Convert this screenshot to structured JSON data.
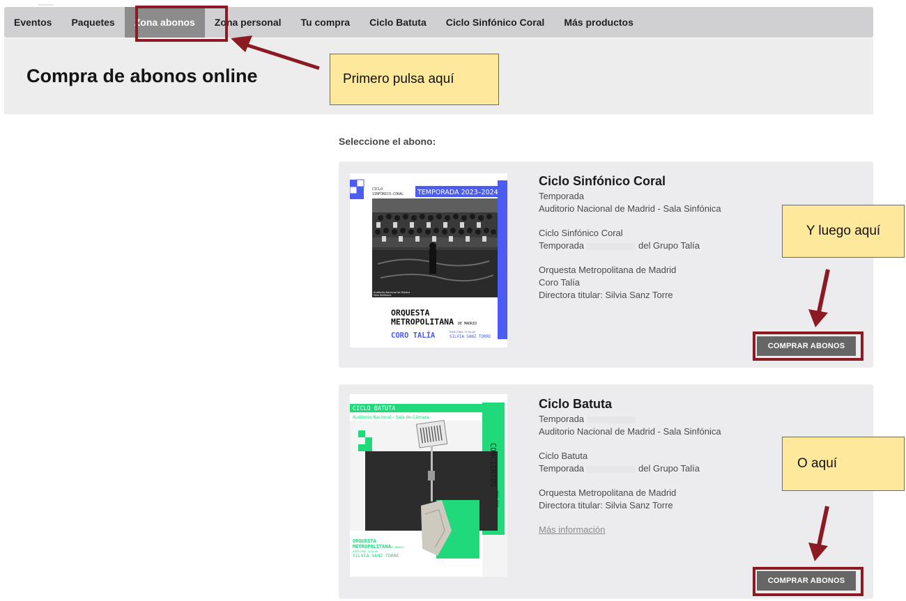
{
  "nav": {
    "items": [
      {
        "label": "Eventos"
      },
      {
        "label": "Paquetes"
      },
      {
        "label": "Zona abonos"
      },
      {
        "label": "Zona personal"
      },
      {
        "label": "Tu compra"
      },
      {
        "label": "Ciclo Batuta"
      },
      {
        "label": "Ciclo Sinfónico Coral"
      },
      {
        "label": "Más productos"
      }
    ],
    "active_index": 2
  },
  "header": {
    "title": "Compra de abonos online"
  },
  "section_label": "Seleccione el abono:",
  "cards": [
    {
      "title": "Ciclo Sinfónico Coral",
      "season": "Temporada",
      "venue": "Auditorio Nacional de Madrid - Sala Sinfónica",
      "cycle": "Ciclo Sinfónico Coral",
      "season_prefix": "Temporada",
      "season_suffix": "del Grupo Talía",
      "performers": [
        "Orquesta Metropolitana de Madrid",
        "Coro Talía",
        "Directora titular: Silvia Sanz Torre"
      ],
      "button_label": "COMPRAR ABONOS",
      "poster": {
        "tag_top": "CICLO",
        "tag_bottom": "SINFÓNICO-CORAL",
        "season_badge": "TEMPORADA 2023–2024",
        "venue_small_1": "Auditorio Nacional de Música",
        "venue_small_2": "Sala Sinfónica",
        "orchestra_1": "ORQUESTA",
        "orchestra_2": "METROPOLITANA",
        "orchestra_suffix": "DE MADRID",
        "choir": "CORO TALÍA",
        "director_label": "DIRECTORA TITULAR",
        "director": "SILVIA SANZ TORRE",
        "accent_color": "#4b5cf0"
      }
    },
    {
      "title": "Ciclo Batuta",
      "season": "Temporada",
      "venue": "Auditorio Nacional de Madrid - Sala Sinfónica",
      "cycle": "Ciclo Batuta",
      "season_prefix": "Temporada",
      "season_suffix": "del Grupo Talía",
      "performers": [
        "Orquesta Metropolitana de Madrid",
        "Directora titular: Silvia Sanz Torre"
      ],
      "more_link": "Más información",
      "button_label": "COMPRAR ABONOS",
      "poster": {
        "cycle_tag": "CICLO BATUTA",
        "venue_tag": "Auditorio Nacional – Sala de Cámara",
        "vertical_text": "CONCIERTOS",
        "vertical_small": "2023 2024",
        "orchestra_1": "ORQUESTA",
        "orchestra_2": "METROPOLITANA",
        "orchestra_suffix": "DE MADRID",
        "director_label": "DIRECTORA TITULAR",
        "director": "SILVIA SANZ TORRE",
        "accent_color": "#1fd97a"
      }
    }
  ],
  "annotations": {
    "callout_1": "Primero pulsa aquí",
    "callout_2": "Y luego aquí",
    "callout_3": "O aquí",
    "annotation_color": "#8b1a22",
    "callout_color": "#fde89b"
  }
}
